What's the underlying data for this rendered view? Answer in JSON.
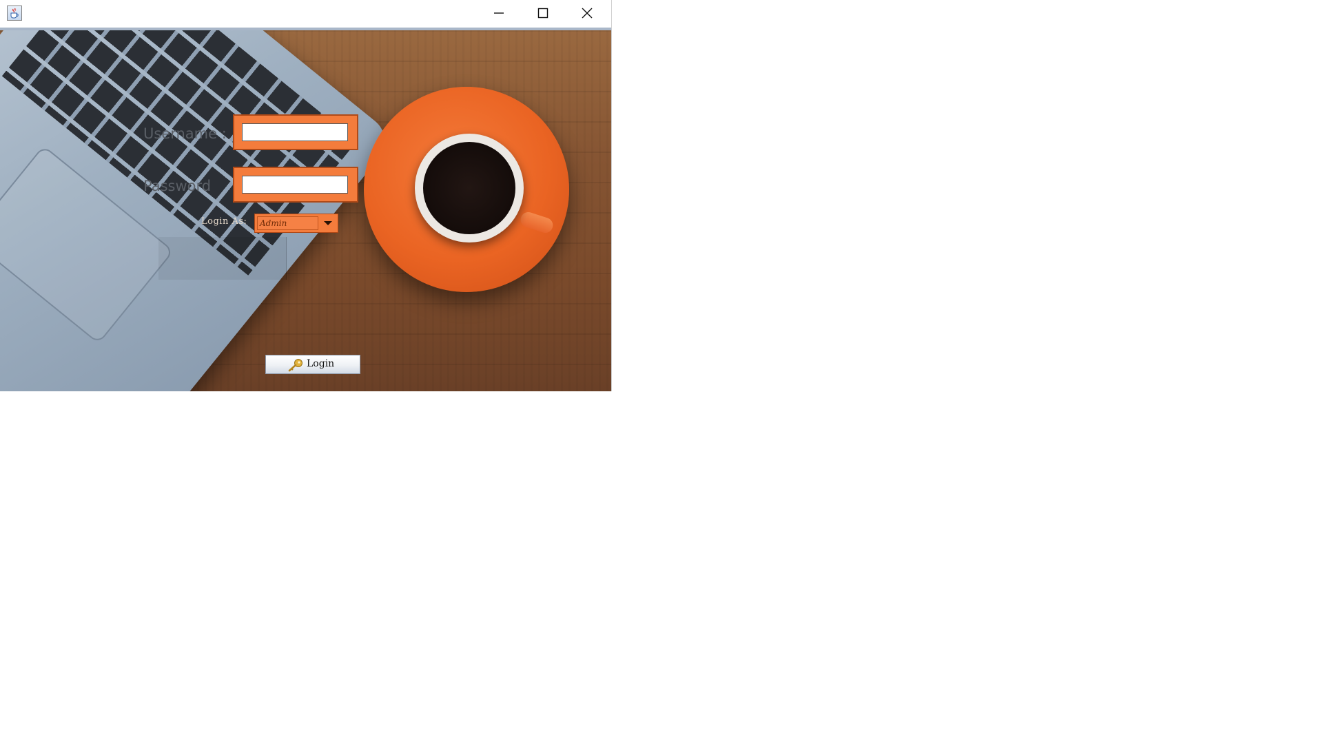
{
  "window": {
    "title": "",
    "app_icon": "java-cup-icon",
    "controls": {
      "minimize": "minimize-icon",
      "maximize": "maximize-icon",
      "close": "close-icon"
    }
  },
  "form": {
    "username_label": "Username :",
    "username_value": "",
    "password_label": "Password",
    "password_value": "",
    "role_label": "Login As:",
    "role_selected": "Admin",
    "login_button_label": "Login",
    "login_button_icon": "key-icon"
  },
  "colors": {
    "accent_orange": "#f47c3c",
    "frame_border": "#b04a18",
    "label_gray": "#5a5f66"
  }
}
